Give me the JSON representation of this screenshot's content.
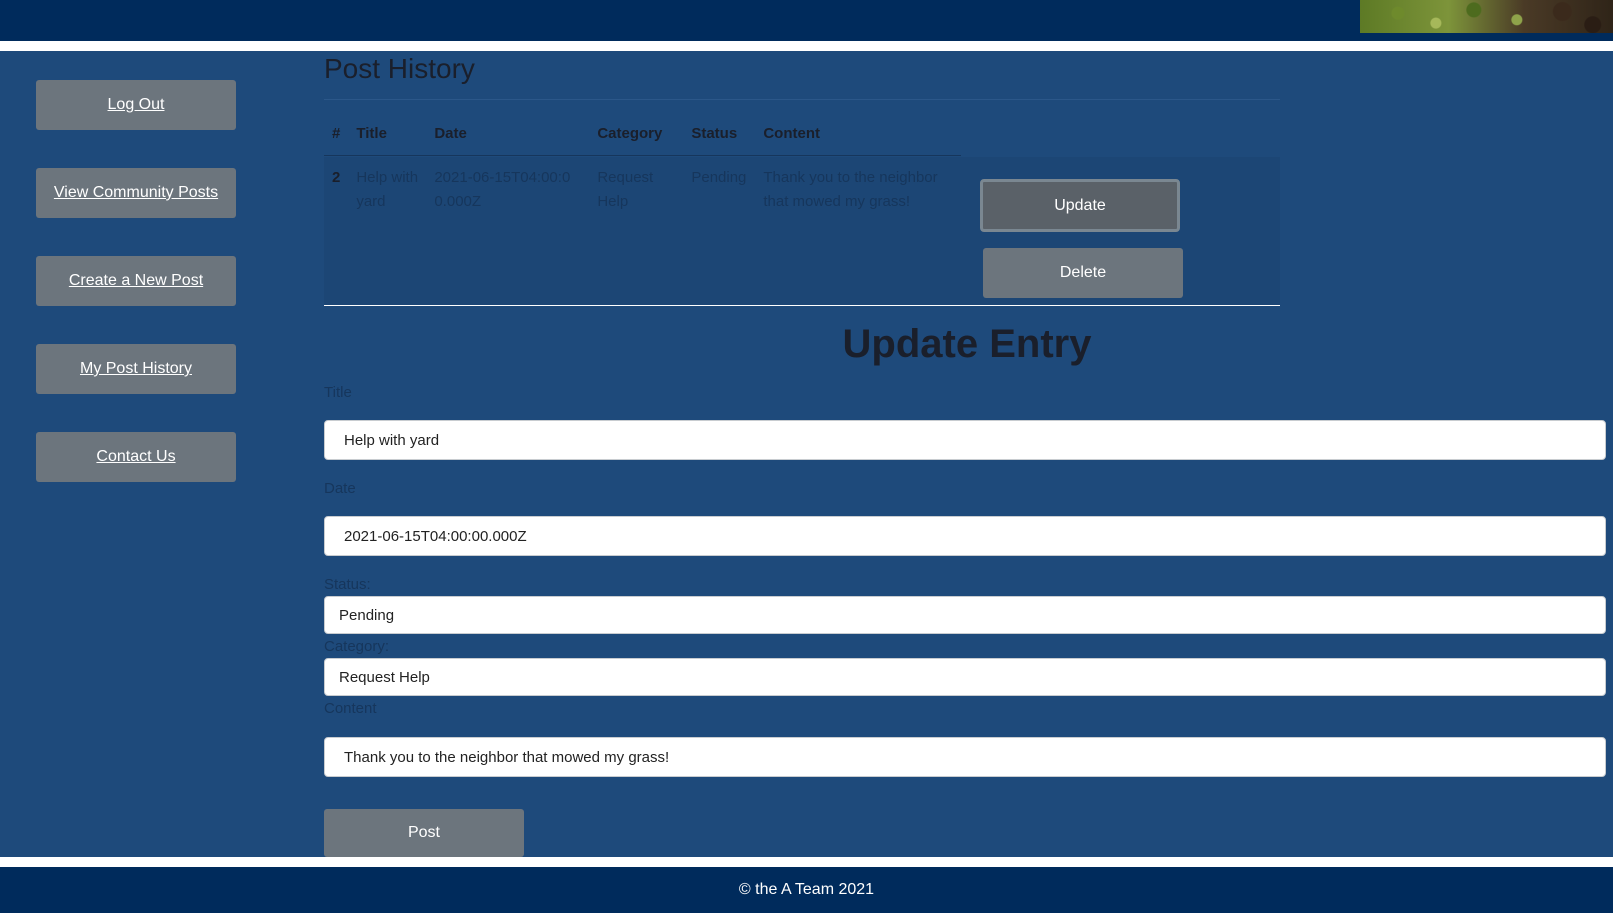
{
  "header": {
    "photo_icon": "garden-photo"
  },
  "nav": {
    "items": [
      {
        "label": "Log Out"
      },
      {
        "label": "View Community Posts"
      },
      {
        "label": "Create a New Post"
      },
      {
        "label": "My Post History"
      },
      {
        "label": "Contact Us"
      }
    ]
  },
  "history": {
    "title": "Post History",
    "columns": [
      "#",
      "Title",
      "Date",
      "Category",
      "Status",
      "Content"
    ],
    "rows": [
      {
        "num": "2",
        "title": "Help with yard",
        "date": "2021-06-15T04:00:00.000Z",
        "category": "Request Help",
        "status": "Pending",
        "content": "Thank you to the neighbor that mowed my grass!"
      }
    ],
    "update_label": "Update",
    "delete_label": "Delete"
  },
  "form": {
    "heading": "Update Entry",
    "title_label": "Title",
    "title_value": "Help with yard",
    "date_label": "Date",
    "date_value": "2021-06-15T04:00:00.000Z",
    "status_label": "Status:",
    "status_value": "Pending",
    "category_label": "Category:",
    "category_value": "Request Help",
    "content_label": "Content",
    "content_value": "Thank you to the neighbor that mowed my grass!",
    "post_label": "Post"
  },
  "footer": {
    "text": "© the A Team 2021"
  },
  "colors": {
    "header": "#002b5c",
    "main": "#1e4a7b",
    "button": "#6c757d"
  }
}
